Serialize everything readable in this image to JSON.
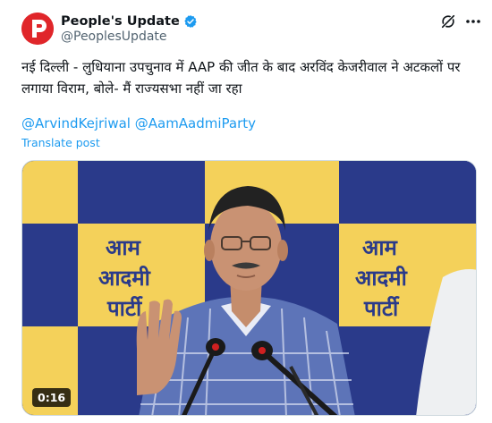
{
  "author": {
    "display_name": "People's Update",
    "handle": "@PeoplesUpdate",
    "verified": true,
    "avatar_letter": "P",
    "avatar_color": "#e0262a"
  },
  "header_icons": {
    "grok": "grok-icon",
    "more": "more-options-icon"
  },
  "tweet": {
    "text": "नई दिल्ली - लुधियाना उपचुनाव में AAP की जीत के बाद अरविंद केजरीवाल ने अटकलों पर लगाया विराम, बोले- मैं राज्यसभा नहीं जा रहा",
    "mentions": [
      "@ArvindKejriwal",
      "@AamAadmiParty"
    ],
    "translate_label": "Translate post"
  },
  "media": {
    "type": "video",
    "duration": "0:16",
    "backdrop_words": [
      "आम",
      "आदमी",
      "पार्टी"
    ]
  },
  "colors": {
    "accent": "#1d9bf0",
    "text": "#0f1419",
    "secondary": "#536471",
    "backdrop_yellow": "#f4d15a",
    "backdrop_blue": "#2a3a8a"
  }
}
